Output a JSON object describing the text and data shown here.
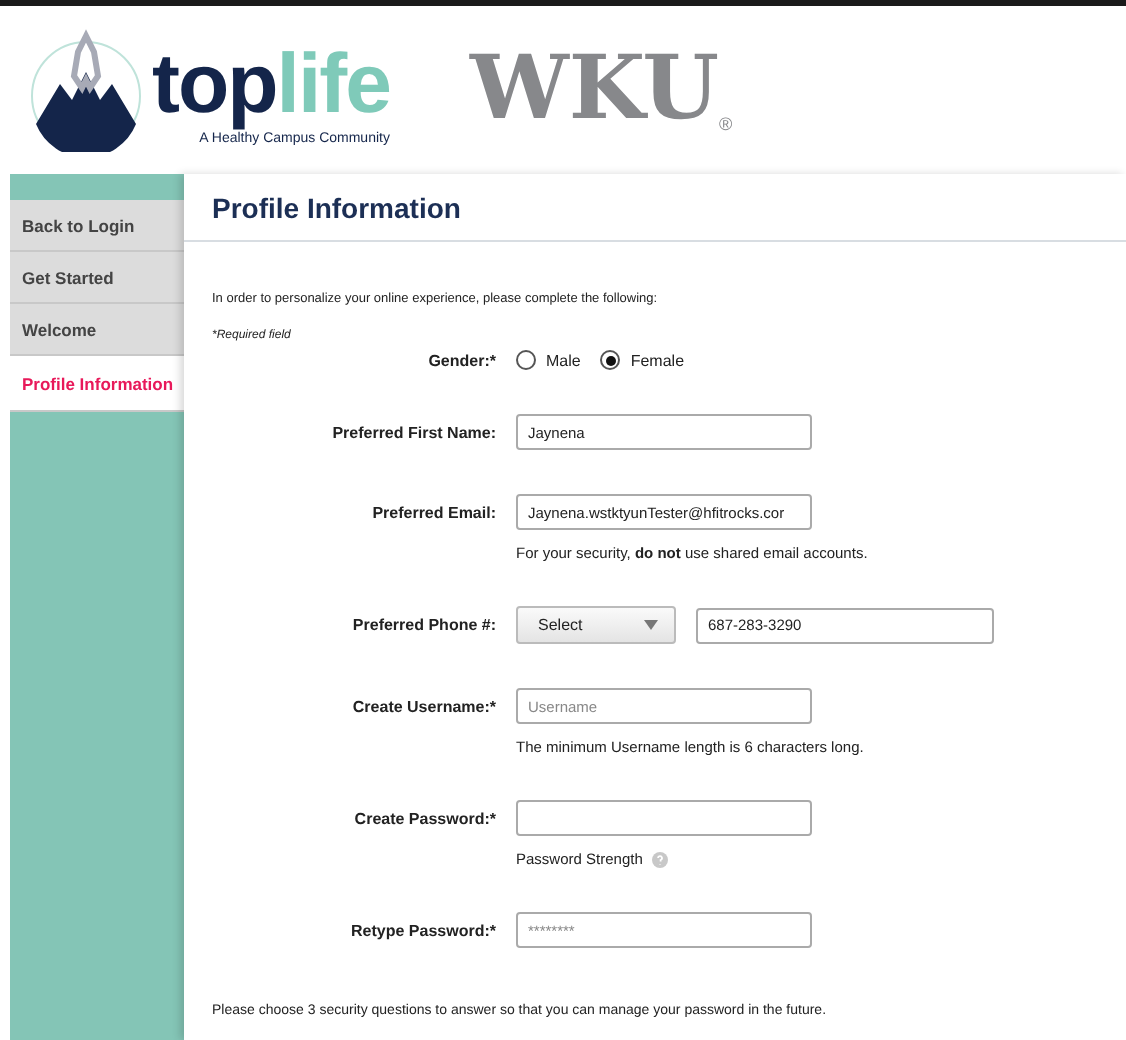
{
  "header": {
    "logo": {
      "top": "top",
      "life": "life",
      "tagline": "A Healthy Campus Community"
    },
    "university": {
      "name": "WKU",
      "mark": "®"
    }
  },
  "sidebar": {
    "items": [
      {
        "label": "Back to Login",
        "selected": false
      },
      {
        "label": "Get Started",
        "selected": false
      },
      {
        "label": "Welcome",
        "selected": false
      },
      {
        "label": "Profile Information",
        "selected": true
      }
    ]
  },
  "panel": {
    "title": "Profile Information",
    "intro": "In order to personalize your online experience, please complete the following:",
    "required_note": "*Required field",
    "fields": [
      {
        "kind": "radio",
        "label": "Gender:*",
        "options": [
          {
            "label": "Male",
            "selected": false
          },
          {
            "label": "Female",
            "selected": true
          }
        ]
      },
      {
        "kind": "text",
        "label": "Preferred First Name:",
        "value": "Jaynena"
      },
      {
        "kind": "text",
        "label": "Preferred Email:",
        "value": "Jaynena.wstktyunTester@hfitrocks.cor",
        "note": "For your security, **do not** use shared email accounts."
      },
      {
        "kind": "phone",
        "label": "Preferred Phone #:",
        "select": "Select",
        "value": "687-283-3290"
      },
      {
        "kind": "text",
        "label": "Create Username:*",
        "placeholder": "Username",
        "note": "The minimum Username length is 6 characters long."
      },
      {
        "kind": "password",
        "label": "Create Password:*",
        "strength_label": "Password Strength"
      },
      {
        "kind": "password",
        "label": "Retype Password:*",
        "placeholder": "********"
      }
    ],
    "footer_text": "Please choose 3 security questions to answer so that you can manage your password in the future."
  }
}
